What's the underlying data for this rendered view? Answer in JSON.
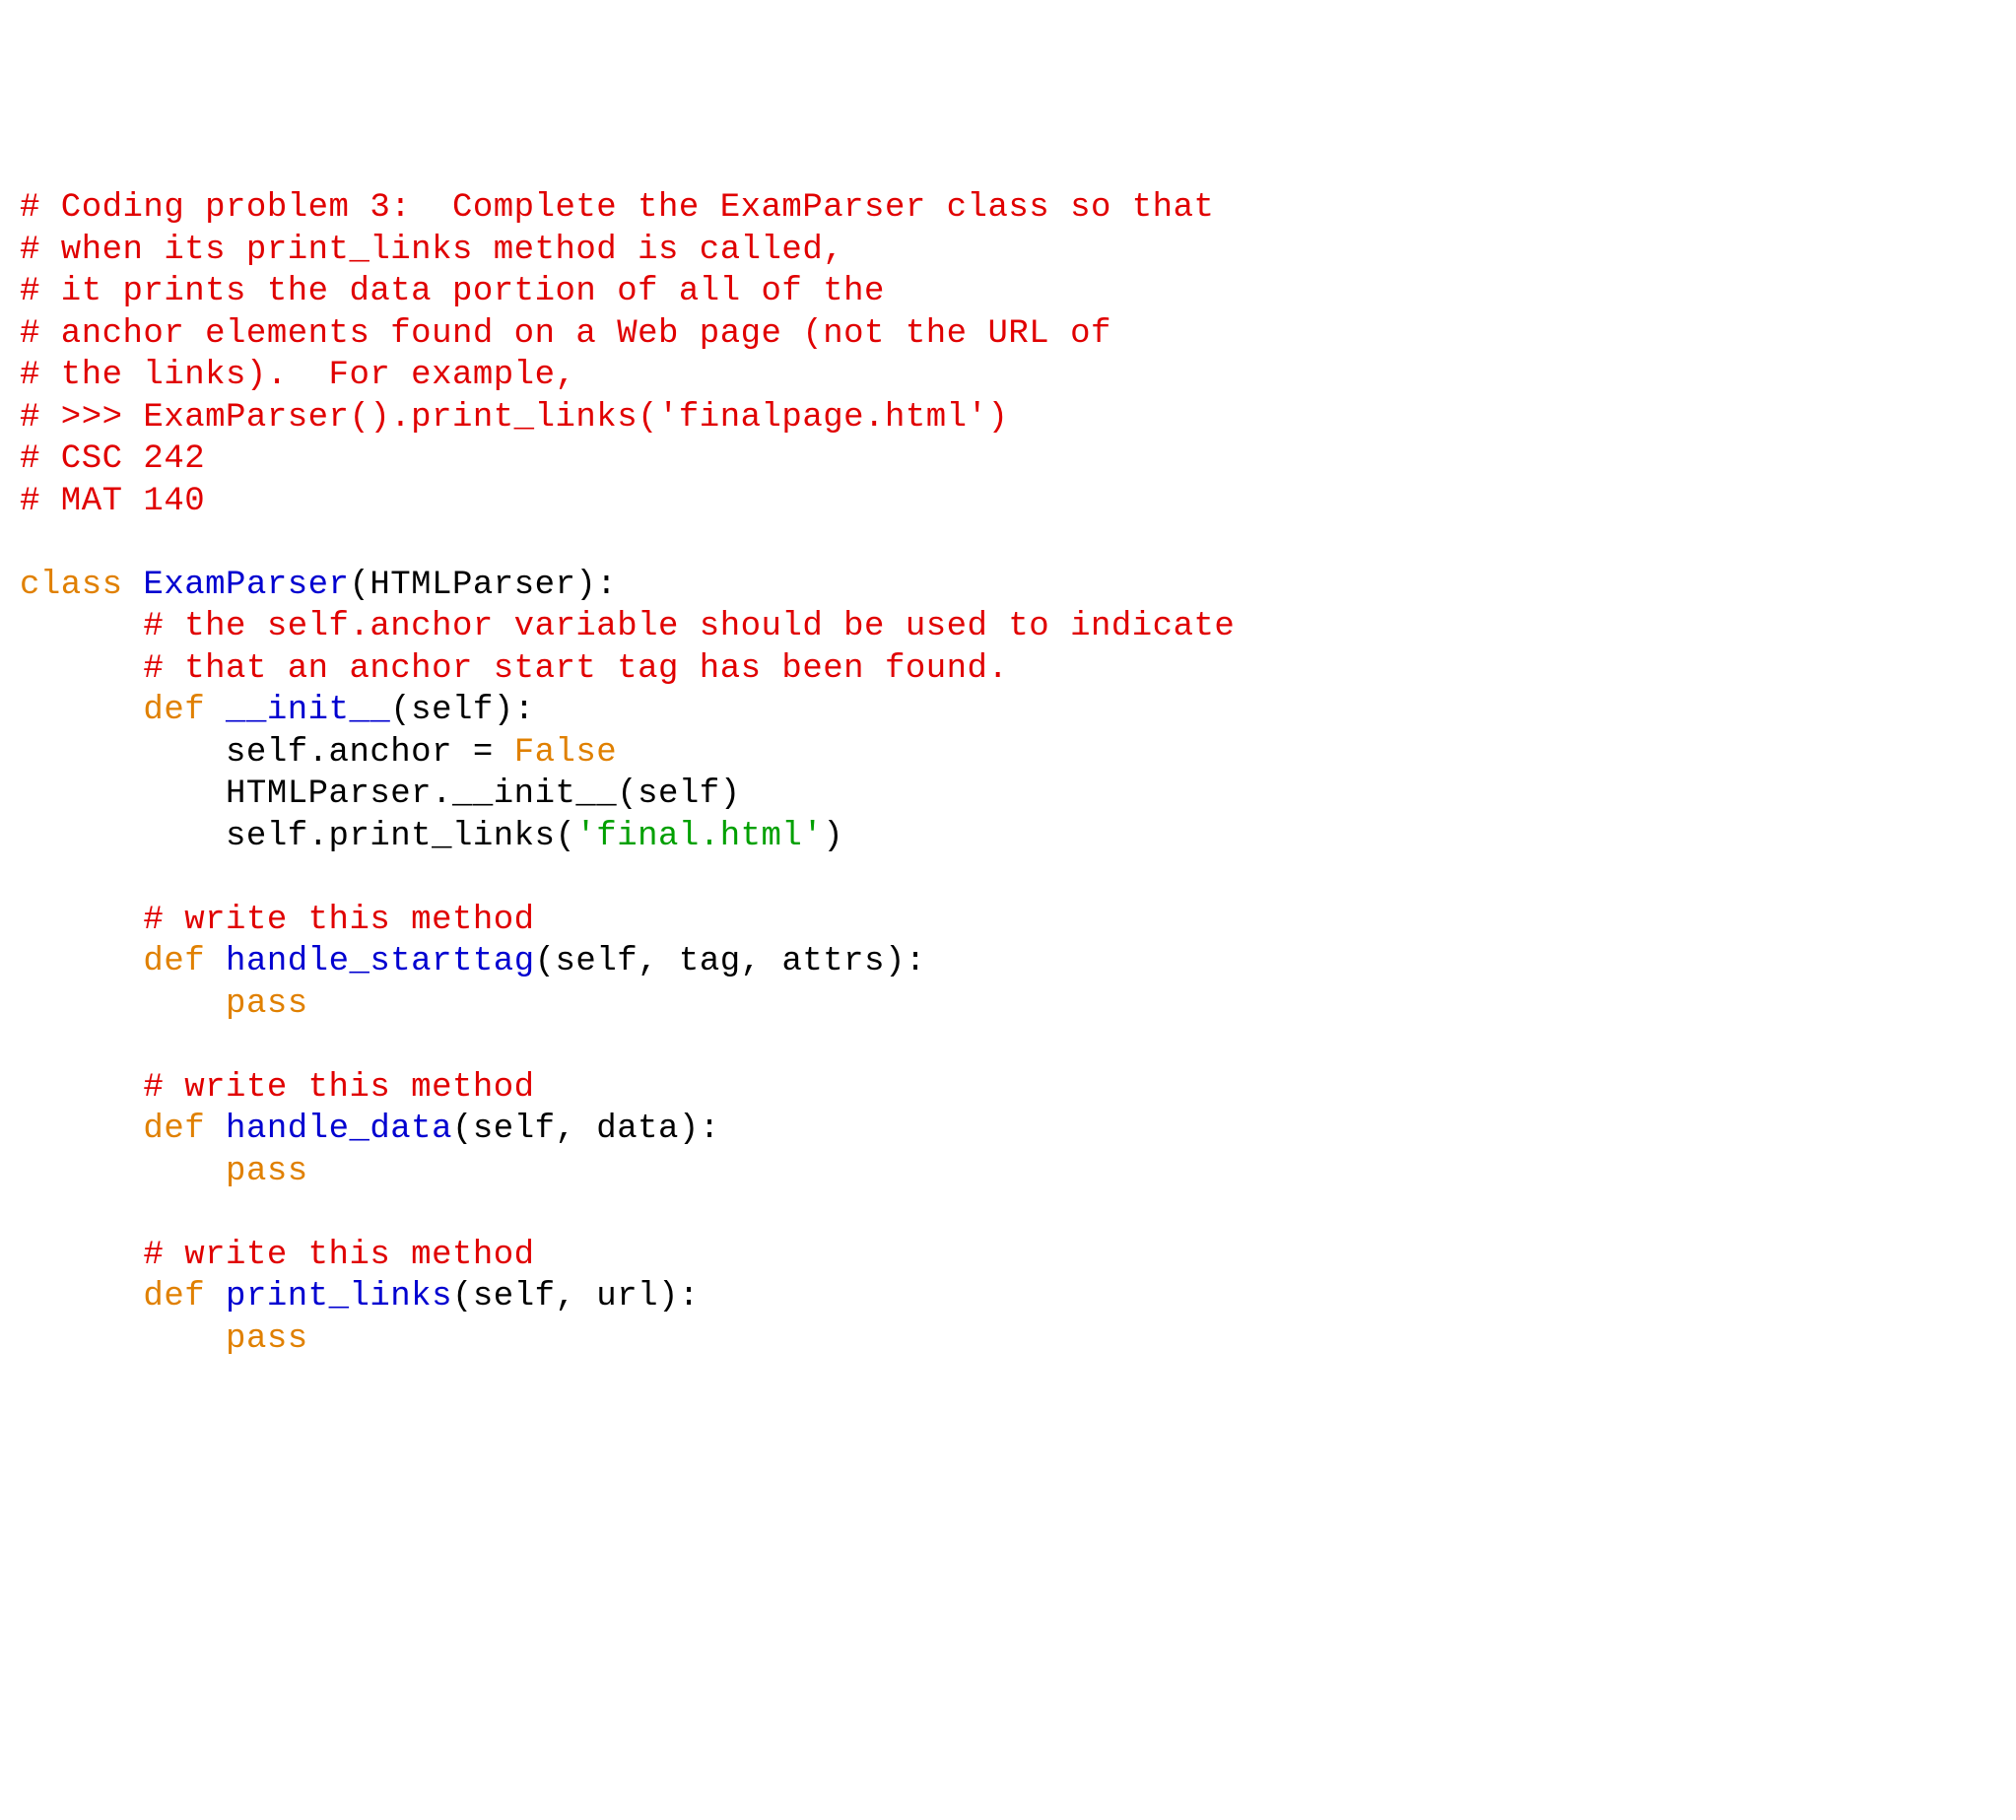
{
  "lines": [
    [
      {
        "cls": "c-comment",
        "t": "# Coding problem 3:  Complete the ExamParser class so that"
      }
    ],
    [
      {
        "cls": "c-comment",
        "t": "# when its print_links method is called,"
      }
    ],
    [
      {
        "cls": "c-comment",
        "t": "# it prints the data portion of all of the"
      }
    ],
    [
      {
        "cls": "c-comment",
        "t": "# anchor elements found on a Web page (not the URL of"
      }
    ],
    [
      {
        "cls": "c-comment",
        "t": "# the links).  For example,"
      }
    ],
    [
      {
        "cls": "c-comment",
        "t": "# >>> ExamParser().print_links('finalpage.html')"
      }
    ],
    [
      {
        "cls": "c-comment",
        "t": "# CSC 242"
      }
    ],
    [
      {
        "cls": "c-comment",
        "t": "# MAT 140"
      }
    ],
    [
      {
        "cls": "c-text",
        "t": ""
      }
    ],
    [
      {
        "cls": "c-keyword",
        "t": "class "
      },
      {
        "cls": "c-def",
        "t": "ExamParser"
      },
      {
        "cls": "c-text",
        "t": "(HTMLParser):"
      }
    ],
    [
      {
        "cls": "c-text",
        "t": "      "
      },
      {
        "cls": "c-comment",
        "t": "# the self.anchor variable should be used to indicate"
      }
    ],
    [
      {
        "cls": "c-text",
        "t": "      "
      },
      {
        "cls": "c-comment",
        "t": "# that an anchor start tag has been found."
      }
    ],
    [
      {
        "cls": "c-text",
        "t": "      "
      },
      {
        "cls": "c-keyword",
        "t": "def "
      },
      {
        "cls": "c-def",
        "t": "__init__"
      },
      {
        "cls": "c-text",
        "t": "(self):"
      }
    ],
    [
      {
        "cls": "c-text",
        "t": "          self.anchor = "
      },
      {
        "cls": "c-keyword",
        "t": "False"
      }
    ],
    [
      {
        "cls": "c-text",
        "t": "          HTMLParser.__init__(self)"
      }
    ],
    [
      {
        "cls": "c-text",
        "t": "          self.print_links("
      },
      {
        "cls": "c-string",
        "t": "'final.html'"
      },
      {
        "cls": "c-text",
        "t": ")"
      }
    ],
    [
      {
        "cls": "c-text",
        "t": ""
      }
    ],
    [
      {
        "cls": "c-text",
        "t": "      "
      },
      {
        "cls": "c-comment",
        "t": "# write this method"
      }
    ],
    [
      {
        "cls": "c-text",
        "t": "      "
      },
      {
        "cls": "c-keyword",
        "t": "def "
      },
      {
        "cls": "c-def",
        "t": "handle_starttag"
      },
      {
        "cls": "c-text",
        "t": "(self, tag, attrs):"
      }
    ],
    [
      {
        "cls": "c-text",
        "t": "          "
      },
      {
        "cls": "c-keyword",
        "t": "pass"
      }
    ],
    [
      {
        "cls": "c-text",
        "t": ""
      }
    ],
    [
      {
        "cls": "c-text",
        "t": "      "
      },
      {
        "cls": "c-comment",
        "t": "# write this method"
      }
    ],
    [
      {
        "cls": "c-text",
        "t": "      "
      },
      {
        "cls": "c-keyword",
        "t": "def "
      },
      {
        "cls": "c-def",
        "t": "handle_data"
      },
      {
        "cls": "c-text",
        "t": "(self, data):"
      }
    ],
    [
      {
        "cls": "c-text",
        "t": "          "
      },
      {
        "cls": "c-keyword",
        "t": "pass"
      }
    ],
    [
      {
        "cls": "c-text",
        "t": ""
      }
    ],
    [
      {
        "cls": "c-text",
        "t": "      "
      },
      {
        "cls": "c-comment",
        "t": "# write this method"
      }
    ],
    [
      {
        "cls": "c-text",
        "t": "      "
      },
      {
        "cls": "c-keyword",
        "t": "def "
      },
      {
        "cls": "c-def",
        "t": "print_links"
      },
      {
        "cls": "c-text",
        "t": "(self, url):"
      }
    ],
    [
      {
        "cls": "c-text",
        "t": "          "
      },
      {
        "cls": "c-keyword",
        "t": "pass"
      }
    ]
  ]
}
